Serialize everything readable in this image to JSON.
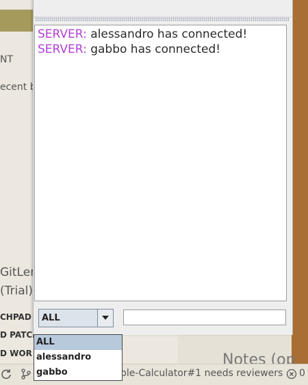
{
  "background_app": {
    "labels": [
      "NT",
      "ecent b"
    ],
    "title_lines": [
      "GitLen",
      "(Trial)"
    ],
    "bold_items": [
      "CHPAD",
      "D PATCH",
      "D WOR"
    ],
    "notes_heading": "Notes (op",
    "status": {
      "text": "ple-Calculator#1 needs reviewers",
      "error_count": "0"
    }
  },
  "chat": {
    "messages": [
      {
        "sender": "SERVER:",
        "text": " alessandro has connected!"
      },
      {
        "sender": "SERVER:",
        "text": " gabbo has connected!"
      }
    ],
    "recipient_select": {
      "value": "ALL",
      "options": [
        "ALL",
        "alessandro",
        "gabbo"
      ]
    },
    "message_input": {
      "value": "",
      "placeholder": ""
    }
  },
  "colors": {
    "sender": "#b13fd6",
    "selected_option": "#b8c9dc",
    "desktop": "#a86e33"
  },
  "icons": [
    "sync-icon",
    "branch-icon",
    "error-icon",
    "dropdown-arrow-icon"
  ]
}
